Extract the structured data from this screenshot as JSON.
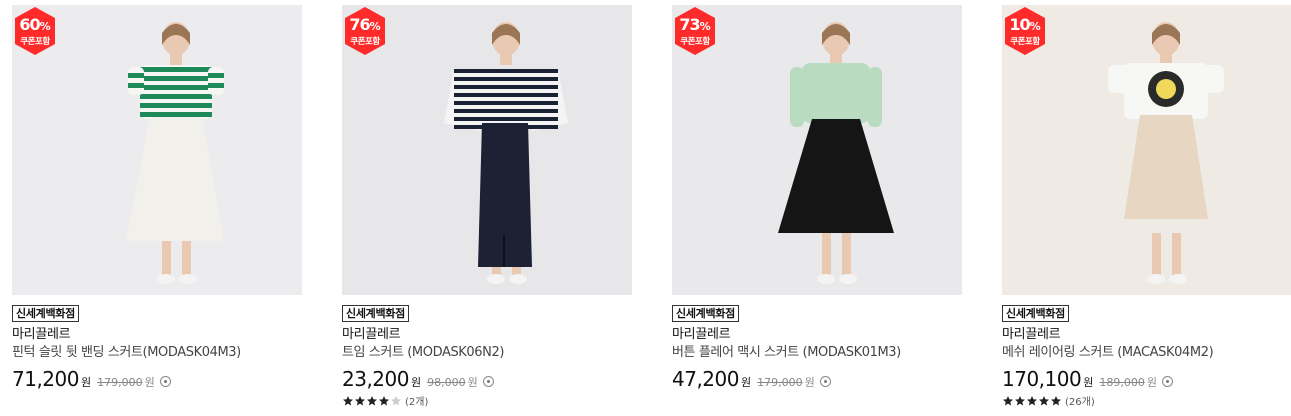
{
  "products": [
    {
      "discount": "60",
      "pct_sign": "%",
      "coupon_label": "쿠폰포함",
      "store": "신세계백화점",
      "brand": "마리끌레르",
      "name": "핀턱 슬릿 뒷 밴딩 스커트(MODASK04M3)",
      "price": "71,200",
      "currency": "원",
      "original_price": "179,000",
      "original_currency": "원",
      "rating": null,
      "review_count": null,
      "photo": {
        "bg": "#ececef",
        "top": "stripe-green",
        "skirt": "#f2f0ea"
      }
    },
    {
      "discount": "76",
      "pct_sign": "%",
      "coupon_label": "쿠폰포함",
      "store": "신세계백화점",
      "brand": "마리끌레르",
      "name": "트임 스커트 (MODASK06N2)",
      "price": "23,200",
      "currency": "원",
      "original_price": "98,000",
      "original_currency": "원",
      "rating": 4,
      "review_count": "(2개)",
      "photo": {
        "bg": "#e7e7ea",
        "top": "stripe-navy",
        "skirt": "#1c2233"
      }
    },
    {
      "discount": "73",
      "pct_sign": "%",
      "coupon_label": "쿠폰포함",
      "store": "신세계백화점",
      "brand": "마리끌레르",
      "name": "버튼 플레어 맥시 스커트 (MODASK01M3)",
      "price": "47,200",
      "currency": "원",
      "original_price": "179,000",
      "original_currency": "원",
      "rating": null,
      "review_count": null,
      "photo": {
        "bg": "#e9e9eb",
        "top": "mint",
        "skirt": "#151515"
      }
    },
    {
      "discount": "10",
      "pct_sign": "%",
      "coupon_label": "쿠폰포함",
      "store": "신세계백화점",
      "brand": "마리끌레르",
      "name": "메쉬 레이어링 스커트 (MACASK04M2)",
      "price": "170,100",
      "currency": "원",
      "original_price": "189,000",
      "original_currency": "원",
      "rating": 5,
      "review_count": "(26개)",
      "photo": {
        "bg": "#efebe4",
        "top": "white-tee",
        "skirt": "#e6d6c2"
      }
    }
  ],
  "colors": {
    "badge_red": "#ff2b2b",
    "star_filled": "#222222",
    "star_empty": "#cccccc"
  },
  "icons": [
    "info-circle-icon",
    "star-icon"
  ]
}
